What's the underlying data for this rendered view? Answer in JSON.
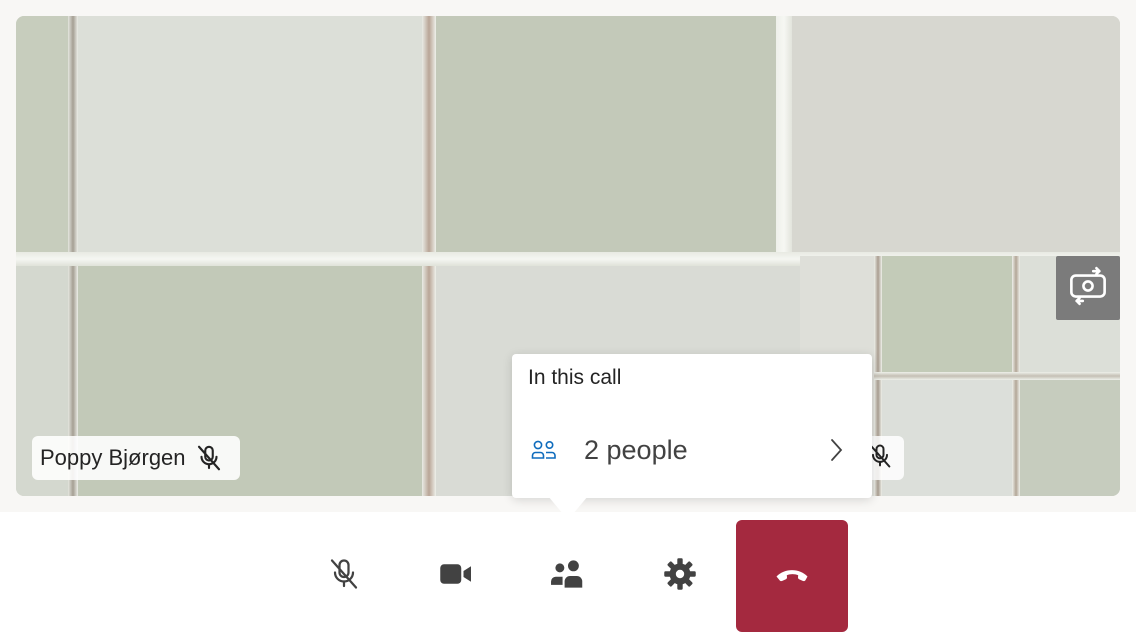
{
  "remote_participant": {
    "name": "Poppy Bjørgen",
    "muted": true,
    "mic_icon": "mic-off-icon"
  },
  "self_view": {
    "muted": true,
    "mic_icon": "mic-off-icon",
    "switch_camera_icon": "camera-switch-icon"
  },
  "call_popover": {
    "title": "In this call",
    "people_count_label": "2 people",
    "people_icon": "people-icon",
    "chevron_icon": "chevron-right-icon",
    "accent_color": "#0f6cbd"
  },
  "controls": {
    "mute": {
      "icon": "mic-off-icon",
      "state": "muted"
    },
    "camera": {
      "icon": "video-camera-icon",
      "state": "on"
    },
    "participants": {
      "icon": "people-icon",
      "state": "open"
    },
    "settings": {
      "icon": "gear-icon"
    },
    "hang_up": {
      "icon": "phone-hangup-icon",
      "color": "#a4293f"
    }
  }
}
